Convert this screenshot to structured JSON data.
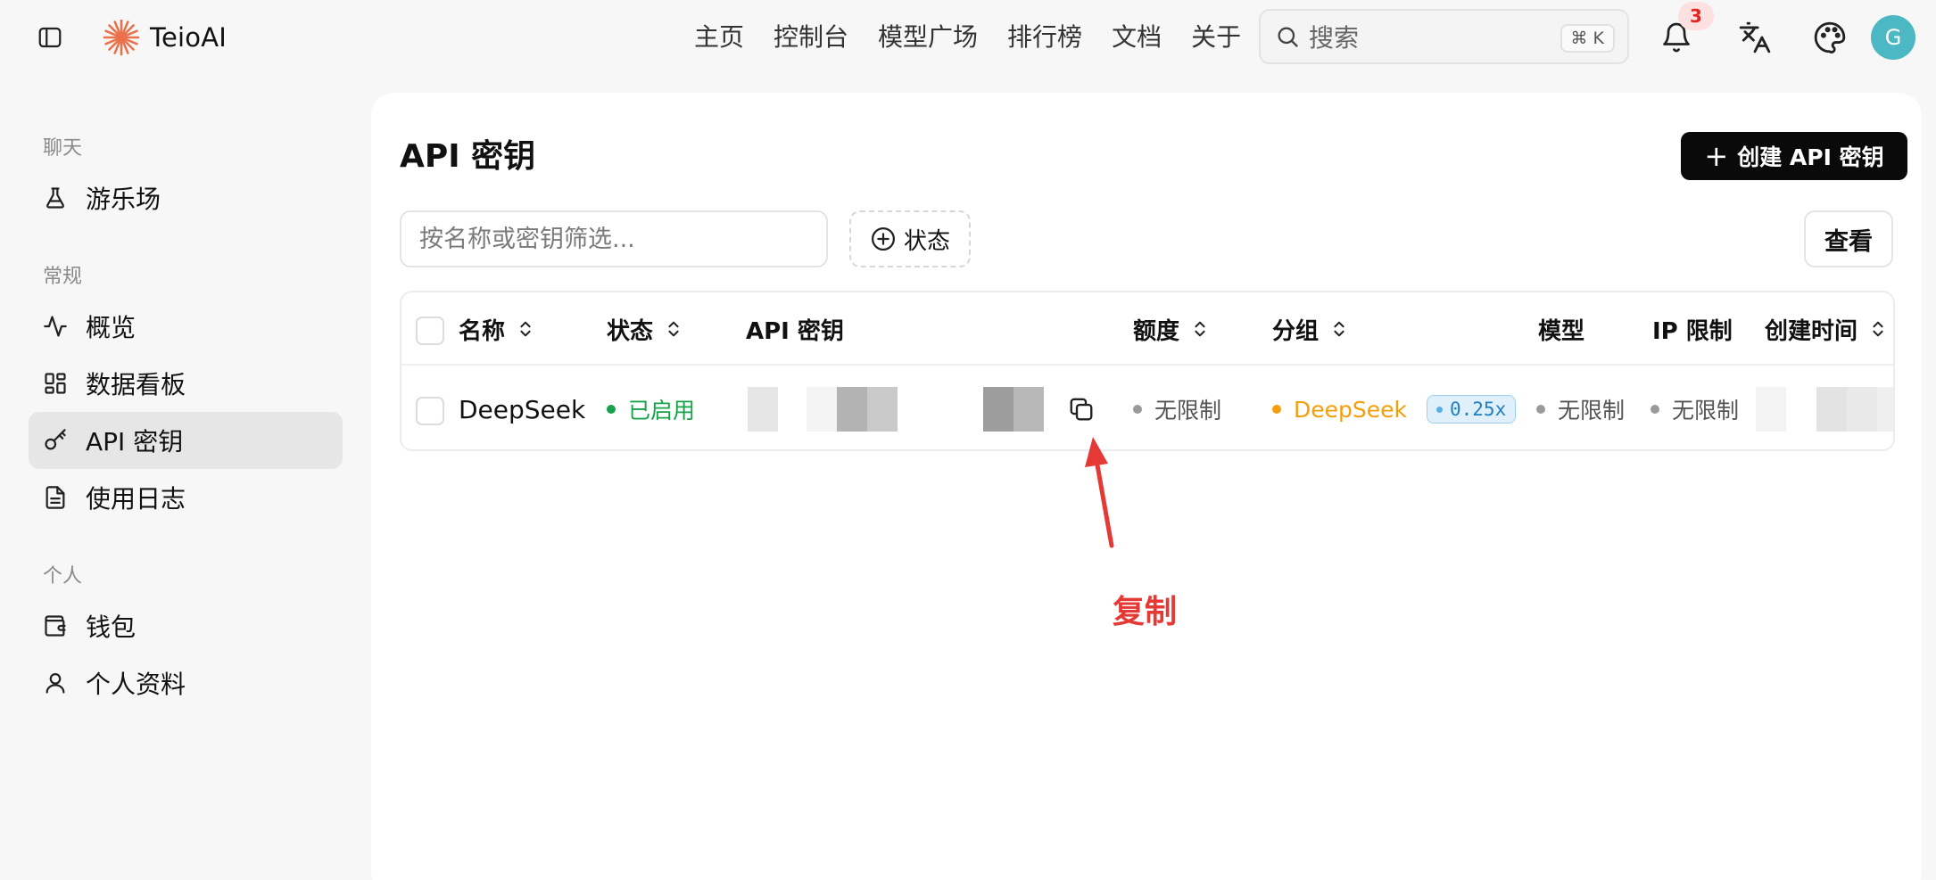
{
  "app": {
    "brand": "TeioAI",
    "brand_color": "#e9724c"
  },
  "nav": {
    "items": [
      "主页",
      "控制台",
      "模型广场",
      "排行榜",
      "文档",
      "关于"
    ]
  },
  "search": {
    "placeholder": "搜索",
    "shortcut": "⌘ K"
  },
  "notifications": {
    "count": "3"
  },
  "user": {
    "avatar_initial": "G",
    "avatar_color": "#4cb8c4"
  },
  "sidebar": {
    "sections": [
      {
        "title": "聊天",
        "items": [
          {
            "label": "游乐场",
            "icon": "flask-icon"
          }
        ]
      },
      {
        "title": "常规",
        "items": [
          {
            "label": "概览",
            "icon": "activity-icon"
          },
          {
            "label": "数据看板",
            "icon": "dashboard-icon"
          },
          {
            "label": "API 密钥",
            "icon": "key-icon",
            "active": true
          },
          {
            "label": "使用日志",
            "icon": "file-text-icon"
          }
        ]
      },
      {
        "title": "个人",
        "items": [
          {
            "label": "钱包",
            "icon": "wallet-icon"
          },
          {
            "label": "个人资料",
            "icon": "user-icon"
          }
        ]
      }
    ]
  },
  "page": {
    "title": "API 密钥",
    "create_button": "创建 API 密钥",
    "filter_placeholder": "按名称或密钥筛选...",
    "status_filter": "状态",
    "view_button": "查看"
  },
  "table": {
    "columns": [
      "名称",
      "状态",
      "API 密钥",
      "额度",
      "分组",
      "模型",
      "IP 限制",
      "创建时间"
    ],
    "rows": [
      {
        "name": "DeepSeek",
        "status": "已启用",
        "api_key": "",
        "quota": "无限制",
        "group": "DeepSeek",
        "group_ratio": "0.25x",
        "models": "无限制",
        "ip_limit": "无限制",
        "created_at": ""
      }
    ]
  },
  "annotation": {
    "label": "复制",
    "color": "#e53935"
  }
}
